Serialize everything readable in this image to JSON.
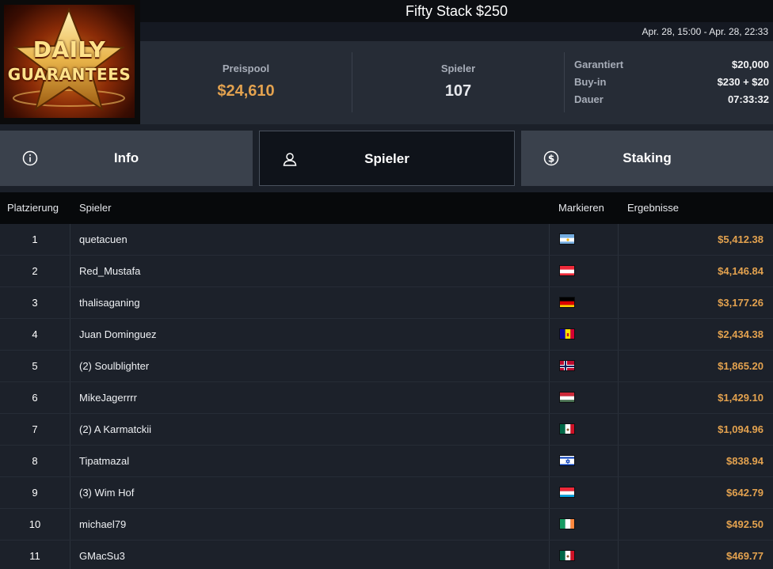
{
  "logo": {
    "line1": "DAILY",
    "line2": "GUARANTEES"
  },
  "tournament": {
    "title": "Fifty Stack $250",
    "dates": "Apr. 28, 15:00 - Apr. 28, 22:33"
  },
  "stats": {
    "prizepool_label": "Preispool",
    "prizepool_value": "$24,610",
    "players_label": "Spieler",
    "players_value": "107",
    "details": [
      {
        "key": "Garantiert",
        "value": "$20,000"
      },
      {
        "key": "Buy-in",
        "value": "$230 + $20"
      },
      {
        "key": "Dauer",
        "value": "07:33:32"
      }
    ]
  },
  "tabs": [
    {
      "label": "Info",
      "icon": "info-icon",
      "active": false
    },
    {
      "label": "Spieler",
      "icon": "user-icon",
      "active": true
    },
    {
      "label": "Staking",
      "icon": "dollar-coin-icon",
      "active": false
    }
  ],
  "table": {
    "headers": {
      "place": "Platzierung",
      "player": "Spieler",
      "flag": "Markieren",
      "result": "Ergebnisse"
    },
    "rows": [
      {
        "place": "1",
        "player": "quetacuen",
        "flag": "ar",
        "result": "$5,412.38"
      },
      {
        "place": "2",
        "player": "Red_Mustafa",
        "flag": "at",
        "result": "$4,146.84"
      },
      {
        "place": "3",
        "player": "thalisaganing",
        "flag": "de",
        "result": "$3,177.26"
      },
      {
        "place": "4",
        "player": "Juan Dominguez",
        "flag": "ad",
        "result": "$2,434.38"
      },
      {
        "place": "5",
        "player": "(2) Soulblighter",
        "flag": "no",
        "result": "$1,865.20"
      },
      {
        "place": "6",
        "player": "MikeJagerrrr",
        "flag": "hu",
        "result": "$1,429.10"
      },
      {
        "place": "7",
        "player": "(2) A Karmatckii",
        "flag": "mx",
        "result": "$1,094.96"
      },
      {
        "place": "8",
        "player": "Tipatmazal",
        "flag": "il",
        "result": "$838.94"
      },
      {
        "place": "9",
        "player": "(3) Wim Hof",
        "flag": "lu",
        "result": "$642.79"
      },
      {
        "place": "10",
        "player": "michael79",
        "flag": "ie",
        "result": "$492.50"
      },
      {
        "place": "11",
        "player": "GMacSu3",
        "flag": "mx",
        "result": "$469.77"
      }
    ]
  },
  "colors": {
    "accent_gold": "#e3a24f",
    "panel": "#262c36",
    "tab": "#3a414c",
    "active_tab": "#0f131a"
  }
}
